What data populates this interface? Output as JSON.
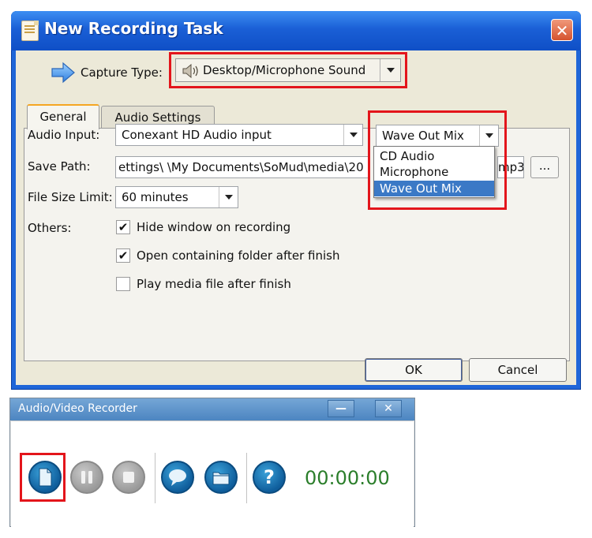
{
  "dialog": {
    "title": "New Recording Task",
    "close_label": "✕",
    "capture_type_label": "Capture Type:",
    "capture_type_value": "Desktop/Microphone Sound",
    "tabs": [
      {
        "label": "General",
        "active": true
      },
      {
        "label": "Audio Settings",
        "active": false
      }
    ],
    "audio_input_label": "Audio Input:",
    "audio_input_value": "Conexant HD Audio input",
    "source_value": "Wave Out Mix",
    "source_options": [
      "CD Audio",
      "Microphone",
      "Wave Out Mix"
    ],
    "source_selected": "Wave Out Mix",
    "save_path_label": "Save Path:",
    "save_path_value": "ettings\\     \\My Documents\\SoMud\\media\\20",
    "save_path_suffix": "mp3",
    "browse_label": "...",
    "file_size_label": "File Size Limit:",
    "file_size_value": "60 minutes",
    "others_label": "Others:",
    "options": [
      {
        "label": "Hide window on recording",
        "checked": true
      },
      {
        "label": "Open containing folder after finish",
        "checked": true
      },
      {
        "label": "Play media file after finish",
        "checked": false
      }
    ],
    "ok_label": "OK",
    "cancel_label": "Cancel"
  },
  "recorder": {
    "title": "Audio/Video Recorder",
    "minimize_label": "—",
    "close_label": "✕",
    "timer": "00:00:00",
    "buttons": [
      "new-document-icon",
      "pause-icon",
      "stop-icon",
      "chat-bubble-icon",
      "folder-icon",
      "help-icon"
    ],
    "help_glyph": "?"
  },
  "colors": {
    "highlight": "#e3151b",
    "titlebar": "#1a5fd6",
    "timer": "#2b7e2b",
    "selection": "#3b79c6"
  }
}
